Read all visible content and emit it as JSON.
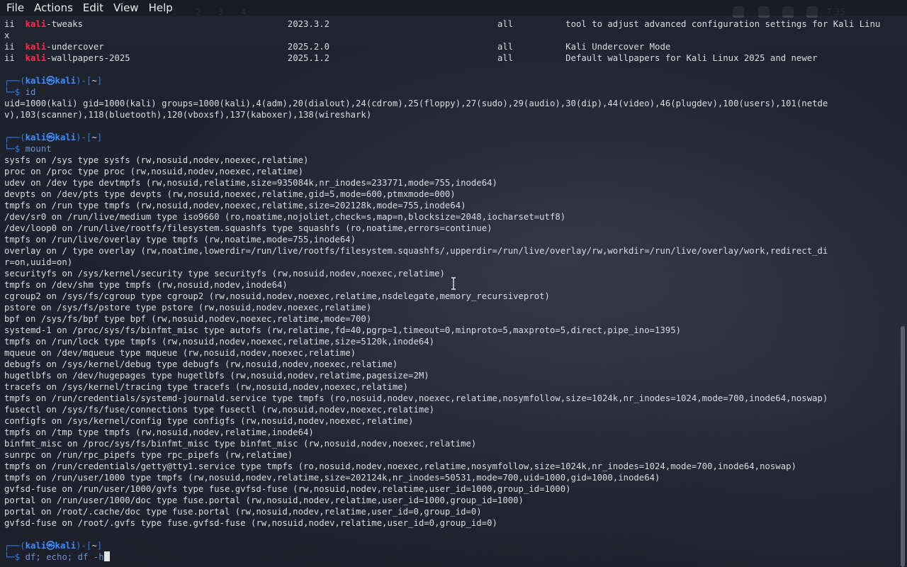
{
  "menubar": [
    "File",
    "Actions",
    "Edit",
    "View",
    "Help"
  ],
  "panel": {
    "workspaces": [
      "1",
      "2",
      "3",
      "4"
    ],
    "clock": "7:35"
  },
  "lines": [
    [
      [
        "ii  ",
        ""
      ],
      [
        "kali",
        "red"
      ],
      [
        "-tweaks                                       2023.3.2                                all          tool to adjust advanced configuration settings for Kali Linu",
        ""
      ]
    ],
    [
      [
        "x",
        ""
      ]
    ],
    [
      [
        "ii  ",
        ""
      ],
      [
        "kali",
        "red"
      ],
      [
        "-undercover                                   2025.2.0                                all          Kali Undercover Mode",
        ""
      ]
    ],
    [
      [
        "ii  ",
        ""
      ],
      [
        "kali",
        "red"
      ],
      [
        "-wallpapers-2025                              2025.1.2                                all          Default wallpapers for Kali Linux 2025 and newer",
        ""
      ]
    ],
    [
      [
        "",
        ""
      ]
    ],
    [
      [
        "┌──(",
        "prompt-bracket"
      ],
      [
        "kali㉿kali",
        "blue"
      ],
      [
        ")-[",
        "prompt-bracket"
      ],
      [
        "~",
        ""
      ],
      [
        "]",
        "prompt-bracket"
      ]
    ],
    [
      [
        "└─$ ",
        "prompt-bracket"
      ],
      [
        "id",
        "cmd"
      ]
    ],
    [
      [
        "uid=1000(kali) gid=1000(kali) groups=1000(kali),4(adm),20(dialout),24(cdrom),25(floppy),27(sudo),29(audio),30(dip),44(video),46(plugdev),100(users),101(netde",
        ""
      ]
    ],
    [
      [
        "v),103(scanner),118(bluetooth),120(vboxsf),137(kaboxer),138(wireshark)",
        ""
      ]
    ],
    [
      [
        "",
        ""
      ]
    ],
    [
      [
        "┌──(",
        "prompt-bracket"
      ],
      [
        "kali㉿kali",
        "blue"
      ],
      [
        ")-[",
        "prompt-bracket"
      ],
      [
        "~",
        ""
      ],
      [
        "]",
        "prompt-bracket"
      ]
    ],
    [
      [
        "└─$ ",
        "prompt-bracket"
      ],
      [
        "mount",
        "cmd"
      ]
    ],
    [
      [
        "sysfs on /sys type sysfs (rw,nosuid,nodev,noexec,relatime)",
        ""
      ]
    ],
    [
      [
        "proc on /proc type proc (rw,nosuid,nodev,noexec,relatime)",
        ""
      ]
    ],
    [
      [
        "udev on /dev type devtmpfs (rw,nosuid,relatime,size=935084k,nr_inodes=233771,mode=755,inode64)",
        ""
      ]
    ],
    [
      [
        "devpts on /dev/pts type devpts (rw,nosuid,noexec,relatime,gid=5,mode=600,ptmxmode=000)",
        ""
      ]
    ],
    [
      [
        "tmpfs on /run type tmpfs (rw,nosuid,nodev,noexec,relatime,size=202128k,mode=755,inode64)",
        ""
      ]
    ],
    [
      [
        "/dev/sr0 on /run/live/medium type iso9660 (ro,noatime,nojoliet,check=s,map=n,blocksize=2048,iocharset=utf8)",
        ""
      ]
    ],
    [
      [
        "/dev/loop0 on /run/live/rootfs/filesystem.squashfs type squashfs (ro,noatime,errors=continue)",
        ""
      ]
    ],
    [
      [
        "tmpfs on /run/live/overlay type tmpfs (rw,noatime,mode=755,inode64)",
        ""
      ]
    ],
    [
      [
        "overlay on / type overlay (rw,noatime,lowerdir=/run/live/rootfs/filesystem.squashfs/,upperdir=/run/live/overlay/rw,workdir=/run/live/overlay/work,redirect_di",
        ""
      ]
    ],
    [
      [
        "r=on,uuid=on)",
        ""
      ]
    ],
    [
      [
        "securityfs on /sys/kernel/security type securityfs (rw,nosuid,nodev,noexec,relatime)",
        ""
      ]
    ],
    [
      [
        "tmpfs on /dev/shm type tmpfs (rw,nosuid,nodev,inode64)",
        ""
      ]
    ],
    [
      [
        "cgroup2 on /sys/fs/cgroup type cgroup2 (rw,nosuid,nodev,noexec,relatime,nsdelegate,memory_recursiveprot)",
        ""
      ]
    ],
    [
      [
        "pstore on /sys/fs/pstore type pstore (rw,nosuid,nodev,noexec,relatime)",
        ""
      ]
    ],
    [
      [
        "bpf on /sys/fs/bpf type bpf (rw,nosuid,nodev,noexec,relatime,mode=700)",
        ""
      ]
    ],
    [
      [
        "systemd-1 on /proc/sys/fs/binfmt_misc type autofs (rw,relatime,fd=40,pgrp=1,timeout=0,minproto=5,maxproto=5,direct,pipe_ino=1395)",
        ""
      ]
    ],
    [
      [
        "tmpfs on /run/lock type tmpfs (rw,nosuid,nodev,noexec,relatime,size=5120k,inode64)",
        ""
      ]
    ],
    [
      [
        "mqueue on /dev/mqueue type mqueue (rw,nosuid,nodev,noexec,relatime)",
        ""
      ]
    ],
    [
      [
        "debugfs on /sys/kernel/debug type debugfs (rw,nosuid,nodev,noexec,relatime)",
        ""
      ]
    ],
    [
      [
        "hugetlbfs on /dev/hugepages type hugetlbfs (rw,nosuid,nodev,relatime,pagesize=2M)",
        ""
      ]
    ],
    [
      [
        "tracefs on /sys/kernel/tracing type tracefs (rw,nosuid,nodev,noexec,relatime)",
        ""
      ]
    ],
    [
      [
        "tmpfs on /run/credentials/systemd-journald.service type tmpfs (ro,nosuid,nodev,noexec,relatime,nosymfollow,size=1024k,nr_inodes=1024,mode=700,inode64,noswap)",
        ""
      ]
    ],
    [
      [
        "fusectl on /sys/fs/fuse/connections type fusectl (rw,nosuid,nodev,noexec,relatime)",
        ""
      ]
    ],
    [
      [
        "configfs on /sys/kernel/config type configfs (rw,nosuid,nodev,noexec,relatime)",
        ""
      ]
    ],
    [
      [
        "tmpfs on /tmp type tmpfs (rw,nosuid,nodev,relatime,inode64)",
        ""
      ]
    ],
    [
      [
        "binfmt_misc on /proc/sys/fs/binfmt_misc type binfmt_misc (rw,nosuid,nodev,noexec,relatime)",
        ""
      ]
    ],
    [
      [
        "sunrpc on /run/rpc_pipefs type rpc_pipefs (rw,relatime)",
        ""
      ]
    ],
    [
      [
        "tmpfs on /run/credentials/getty@tty1.service type tmpfs (ro,nosuid,nodev,noexec,relatime,nosymfollow,size=1024k,nr_inodes=1024,mode=700,inode64,noswap)",
        ""
      ]
    ],
    [
      [
        "tmpfs on /run/user/1000 type tmpfs (rw,nosuid,nodev,relatime,size=202124k,nr_inodes=50531,mode=700,uid=1000,gid=1000,inode64)",
        ""
      ]
    ],
    [
      [
        "gvfsd-fuse on /run/user/1000/gvfs type fuse.gvfsd-fuse (rw,nosuid,nodev,relatime,user_id=1000,group_id=1000)",
        ""
      ]
    ],
    [
      [
        "portal on /run/user/1000/doc type fuse.portal (rw,nosuid,nodev,relatime,user_id=1000,group_id=1000)",
        ""
      ]
    ],
    [
      [
        "portal on /root/.cache/doc type fuse.portal (rw,nosuid,nodev,relatime,user_id=0,group_id=0)",
        ""
      ]
    ],
    [
      [
        "gvfsd-fuse on /root/.gvfs type fuse.gvfsd-fuse (rw,nosuid,nodev,relatime,user_id=0,group_id=0)",
        ""
      ]
    ],
    [
      [
        "",
        ""
      ]
    ],
    [
      [
        "┌──(",
        "prompt-bracket"
      ],
      [
        "kali㉿kali",
        "blue"
      ],
      [
        ")-[",
        "prompt-bracket"
      ],
      [
        "~",
        ""
      ],
      [
        "]",
        "prompt-bracket"
      ]
    ],
    [
      [
        "└─$ ",
        "prompt-bracket"
      ],
      [
        "df; echo; df -h",
        "cmd"
      ],
      [
        "",
        "cursor"
      ]
    ]
  ],
  "colors": {
    "username": "#ff2b4a",
    "prompt": "#2f7ff0",
    "command": "#6b8fd4",
    "text": "#d8dce2",
    "background": "#1b1e28"
  },
  "icons": [
    "text-cursor-icon"
  ]
}
